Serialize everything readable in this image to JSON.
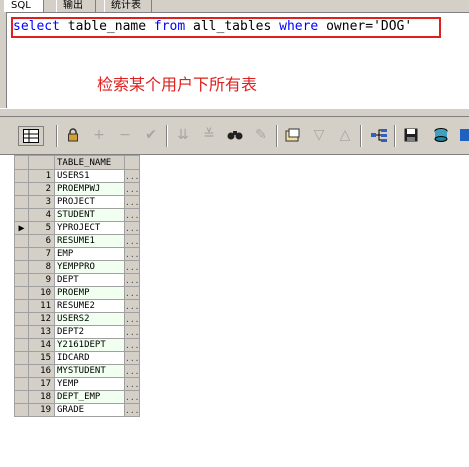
{
  "tabs": [
    "SQL",
    "输出",
    "统计表"
  ],
  "editor": {
    "sql": {
      "kw_select": "select",
      "p1": " table_name ",
      "kw_from": "from",
      "p2": " all_tables ",
      "kw_where": "where",
      "p3": " owner=",
      "value": "'DOG'"
    },
    "annotation": "检索某个用户下所有表"
  },
  "toolbar": {
    "icons": [
      "grid-icon",
      "lock-icon",
      "add-record-icon",
      "delete-record-icon",
      "post-icon",
      "filter-down-icon",
      "filter-clear-icon",
      "find-icon",
      "clear-icon",
      "export-icon",
      "next-icon",
      "prev-icon",
      "explain-icon",
      "save-icon",
      "db-icon",
      "more-icon"
    ]
  },
  "grid": {
    "column_header": "TABLE_NAME",
    "cell_button": "...",
    "current_row_marker": "▶",
    "rows": [
      {
        "num": "1",
        "name": "USERS1"
      },
      {
        "num": "2",
        "name": "PROEMPWJ"
      },
      {
        "num": "3",
        "name": "PROJECT"
      },
      {
        "num": "4",
        "name": "STUDENT"
      },
      {
        "num": "5",
        "name": "YPROJECT",
        "current": true
      },
      {
        "num": "6",
        "name": "RESUME1"
      },
      {
        "num": "7",
        "name": "EMP"
      },
      {
        "num": "8",
        "name": "YEMPPRO"
      },
      {
        "num": "9",
        "name": "DEPT"
      },
      {
        "num": "10",
        "name": "PROEMP"
      },
      {
        "num": "11",
        "name": "RESUME2"
      },
      {
        "num": "12",
        "name": "USERS2"
      },
      {
        "num": "13",
        "name": "DEPT2"
      },
      {
        "num": "14",
        "name": "Y2161DEPT"
      },
      {
        "num": "15",
        "name": "IDCARD"
      },
      {
        "num": "16",
        "name": "MYSTUDENT"
      },
      {
        "num": "17",
        "name": "YEMP"
      },
      {
        "num": "18",
        "name": "DEPT_EMP"
      },
      {
        "num": "19",
        "name": "GRADE"
      }
    ]
  }
}
